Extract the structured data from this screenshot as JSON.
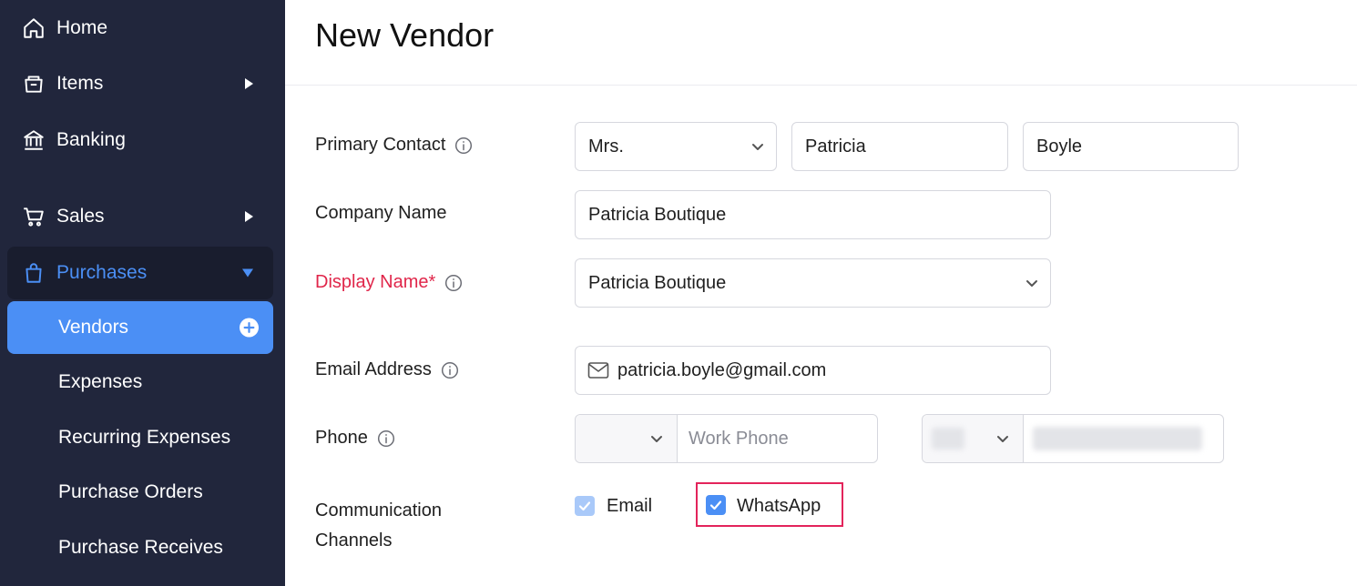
{
  "sidebar": {
    "items": [
      {
        "label": "Home",
        "icon": "home-icon"
      },
      {
        "label": "Items",
        "icon": "box-icon"
      },
      {
        "label": "Banking",
        "icon": "bank-icon"
      },
      {
        "label": "Sales",
        "icon": "cart-icon"
      },
      {
        "label": "Purchases",
        "icon": "shopping-bag-icon"
      }
    ],
    "sub_items": [
      {
        "label": "Vendors"
      },
      {
        "label": "Expenses"
      },
      {
        "label": "Recurring Expenses"
      },
      {
        "label": "Purchase Orders"
      },
      {
        "label": "Purchase Receives"
      }
    ]
  },
  "page": {
    "title": "New Vendor"
  },
  "form": {
    "primary_contact": {
      "label": "Primary Contact",
      "salutation": "Mrs.",
      "first_name": "Patricia",
      "last_name": "Boyle"
    },
    "company_name": {
      "label": "Company Name",
      "value": "Patricia Boutique"
    },
    "display_name": {
      "label": "Display Name*",
      "value": "Patricia Boutique"
    },
    "email": {
      "label": "Email Address",
      "value": "patricia.boyle@gmail.com"
    },
    "phone": {
      "label": "Phone",
      "work_placeholder": "Work Phone"
    },
    "channels": {
      "label_line1": "Communication",
      "label_line2": "Channels",
      "email_label": "Email",
      "whatsapp_label": "WhatsApp",
      "email_checked": true,
      "whatsapp_checked": true
    }
  },
  "colors": {
    "sidebar_bg": "#21263c",
    "accent": "#4b8ff5",
    "required": "#e0264a",
    "highlight": "#e3245b"
  }
}
